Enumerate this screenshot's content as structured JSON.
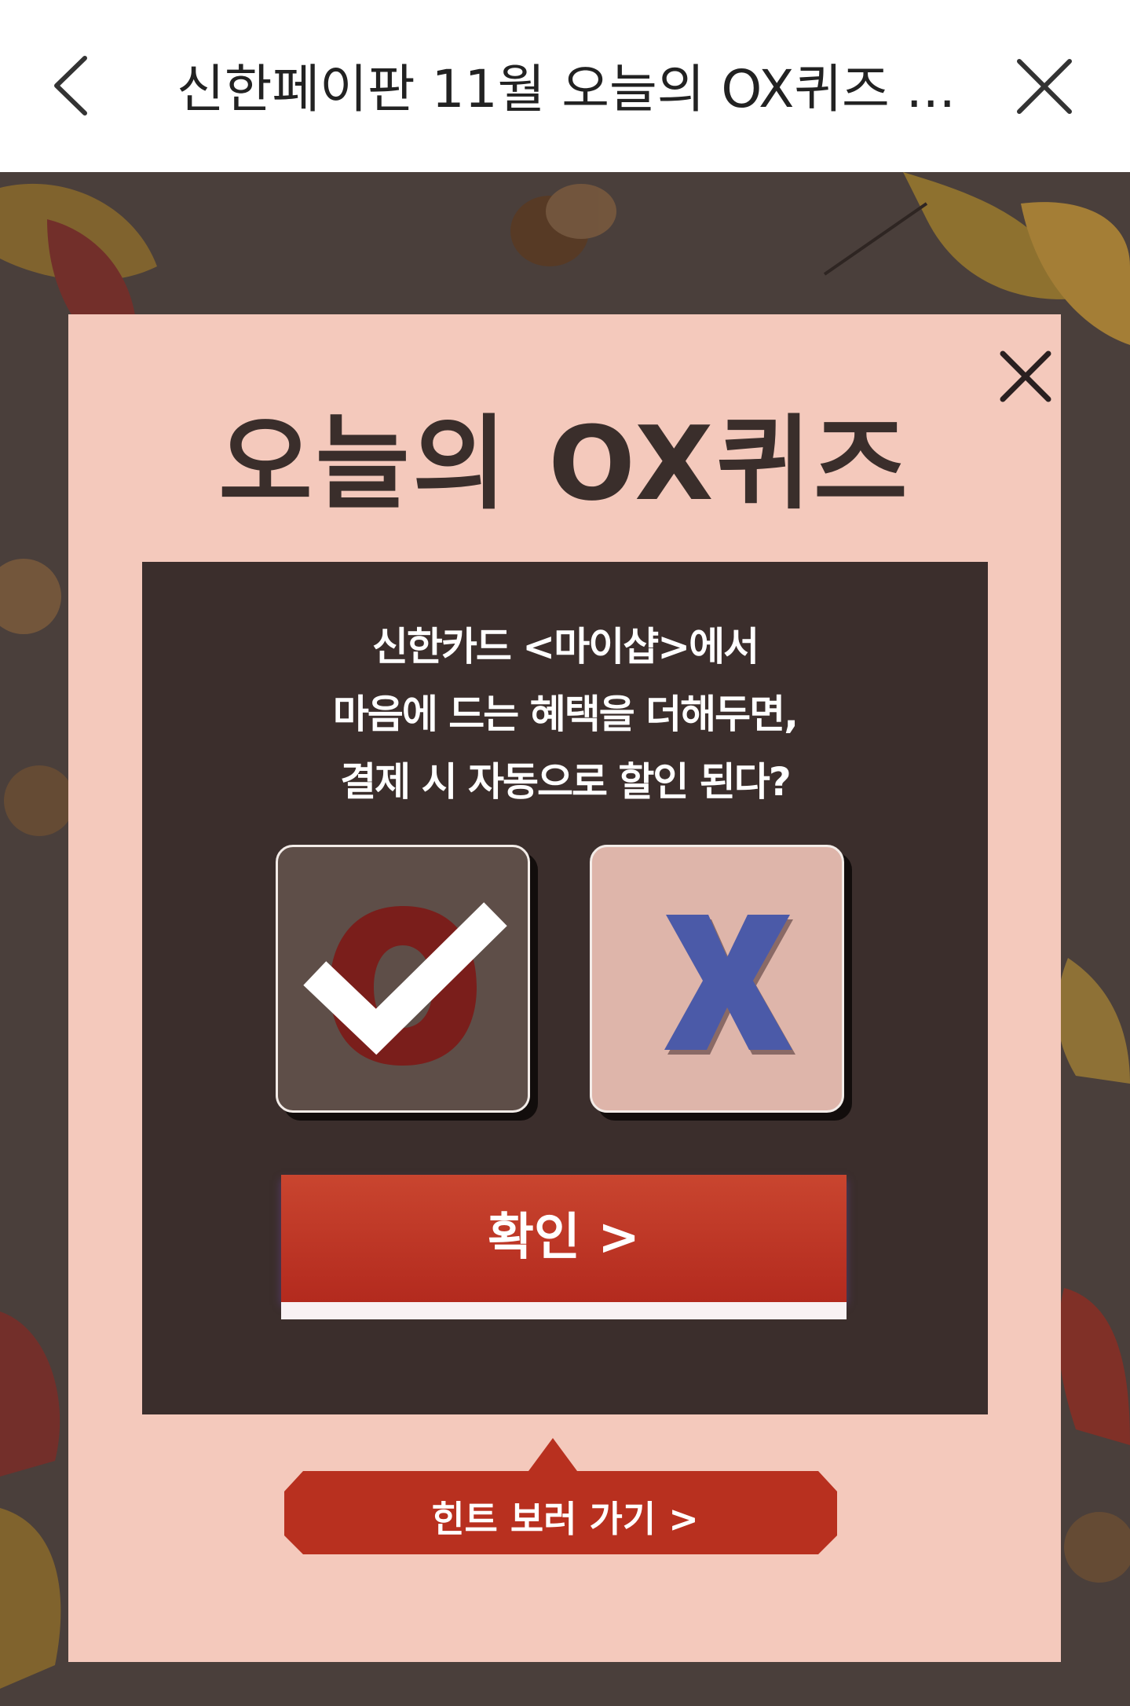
{
  "header": {
    "title": "신한페이판 11월 오늘의 OX퀴즈 ..."
  },
  "popup": {
    "title": "오늘의 OX퀴즈",
    "question_lines": [
      "신한카드 <마이샵>에서",
      "마음에 드는 혜택을 더해두면,",
      "결제 시 자동으로 할인 된다?"
    ],
    "options": {
      "o": {
        "label": "O",
        "selected": true
      },
      "x": {
        "label": "X",
        "selected": false
      }
    },
    "confirm_label": "확인 >",
    "hint_label": "힌트 보러 가기 >"
  },
  "colors": {
    "popup_bg": "#f4c9bc",
    "question_box": "#3b2e2c",
    "confirm_red": "#c23a26",
    "o_red": "#7a1e1b",
    "x_blue": "#4b5aa8"
  },
  "icons": [
    "back-arrow-icon",
    "close-icon",
    "checkmark-icon"
  ]
}
